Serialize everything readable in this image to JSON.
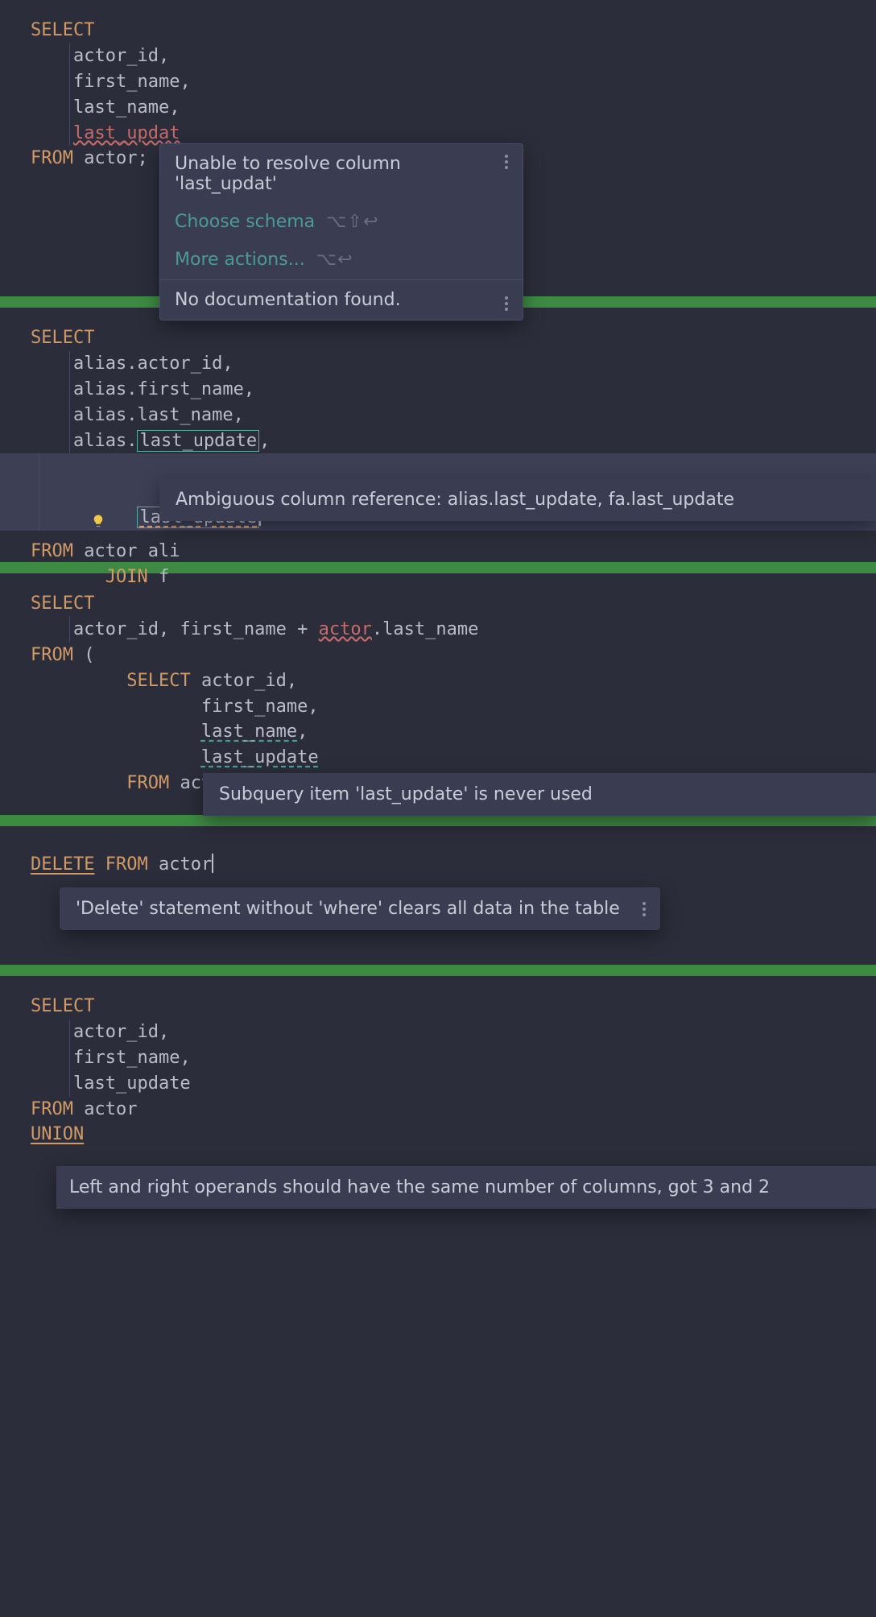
{
  "block1": {
    "select": "SELECT",
    "col1": "actor_id",
    "col2": "first_name",
    "col3": "last_name",
    "col4_err": "last_updat",
    "from": "FROM",
    "table": "actor",
    "semi": ";",
    "tooltip": {
      "msg": "Unable to resolve column 'last_updat'",
      "action1": "Choose schema",
      "shortcut1": "⌥⇧↩",
      "action2": "More actions...",
      "shortcut2": "⌥↩",
      "doc": "No documentation found."
    }
  },
  "block2": {
    "select": "SELECT",
    "c1": "alias.actor_id",
    "c2": "alias.first_name",
    "c3": "alias.last_name",
    "c4_pre": "alias.",
    "c4_box": "last_update",
    "c5_box": "last_update",
    "from": "FROM",
    "table": "actor",
    "alias": "ali",
    "join": "JOIN",
    "jt": "f",
    "tooltip": "Ambiguous column reference: alias.last_update, fa.last_update"
  },
  "block3": {
    "select": "SELECT",
    "row1a": "actor_id",
    "row1b": "first_name",
    "plus": "+",
    "row1c": "actor",
    "row1d": ".last_name",
    "from": "FROM",
    "paren": "(",
    "inner_select": "SELECT",
    "ic1": "actor_id",
    "ic2": "first_name",
    "ic3": "last_name",
    "ic4": "last_update",
    "inner_from": "FROM",
    "inner_table": "actor",
    "tooltip": "Subquery item 'last_update' is never used"
  },
  "block4": {
    "delete": "DELETE",
    "from": "FROM",
    "table": "actor",
    "tooltip": "'Delete' statement without 'where' clears all data in the table"
  },
  "block5": {
    "select": "SELECT",
    "c1": "actor_id",
    "c2": "first_name",
    "c3": "last_update",
    "from": "FROM",
    "table": "actor",
    "union": "UNION",
    "tooltip": "Left and right operands should have the same number of columns, got 3 and 2"
  }
}
